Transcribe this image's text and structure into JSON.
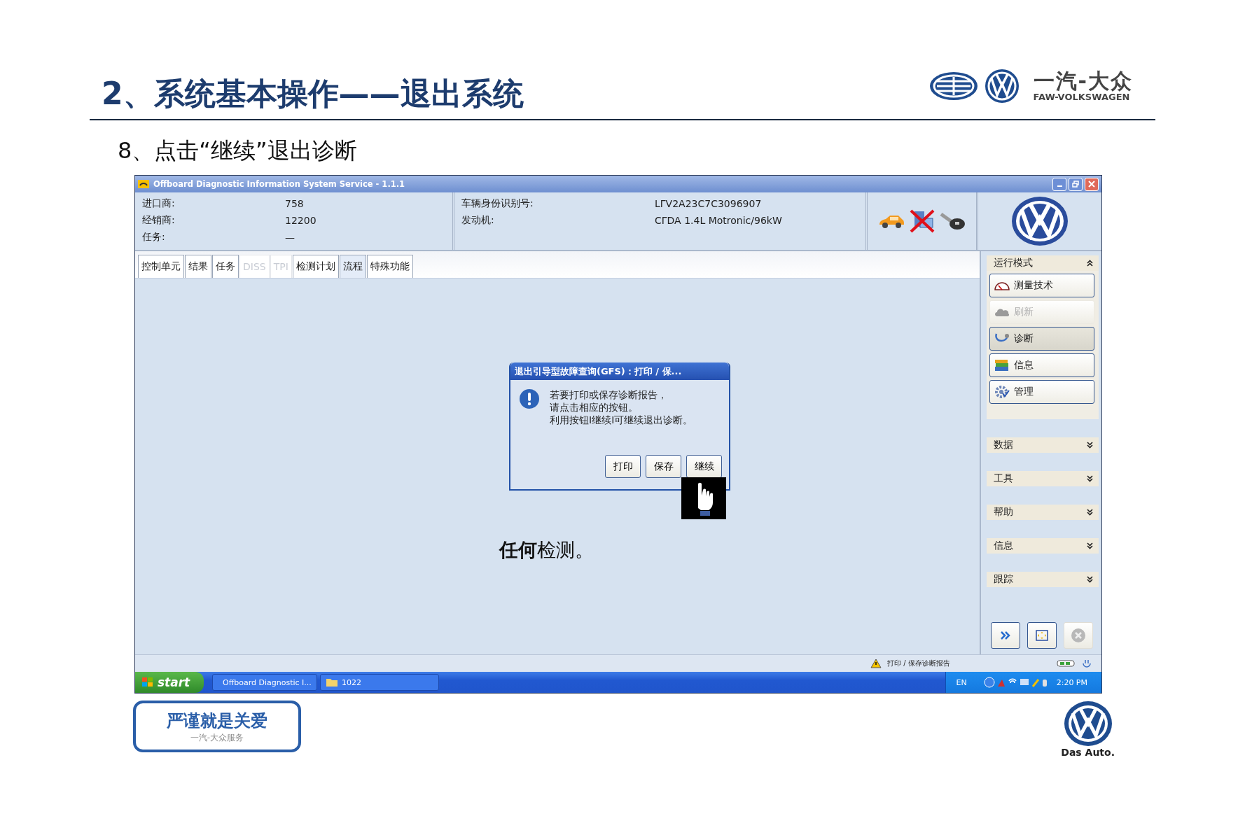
{
  "slide": {
    "title": "2、系统基本操作——退出系统",
    "subtitle": "8、点击“继续”退出诊断"
  },
  "brand": {
    "name_cn": "一汽-大众",
    "name_en": "FAW-VOLKSWAGEN"
  },
  "window": {
    "title": "Offboard Diagnostic Information System Service - 1.1.1"
  },
  "header_info": {
    "left": [
      {
        "label": "进口商:",
        "value": "758"
      },
      {
        "label": "经销商:",
        "value": "12200"
      },
      {
        "label": "任务:",
        "value": "—"
      }
    ],
    "right": [
      {
        "label": "车辆身份识别号:",
        "value": "LΓV2A23C7C3096907"
      },
      {
        "label": "发动机:",
        "value": "CΓDA 1.4L Motronic/96kW"
      }
    ]
  },
  "tabs": [
    {
      "label": "控制单元",
      "selected": false,
      "disabled": false
    },
    {
      "label": "结果",
      "selected": false,
      "disabled": false
    },
    {
      "label": "任务",
      "selected": false,
      "disabled": false
    },
    {
      "label": "DISS",
      "selected": false,
      "disabled": true
    },
    {
      "label": "TPI",
      "selected": false,
      "disabled": true
    },
    {
      "label": "检测计划",
      "selected": false,
      "disabled": false
    },
    {
      "label": "流程",
      "selected": true,
      "disabled": false
    },
    {
      "label": "特殊功能",
      "selected": false,
      "disabled": false
    }
  ],
  "dialog": {
    "title": "退出引导型故障查询(GFS)：打印 / 保...",
    "message_lines": [
      "若要打印或保存诊断报告，",
      "请点击相应的按钮。",
      "利用按钮I继续I可继续退出诊断。"
    ],
    "buttons": [
      "打印",
      "保存",
      "继续"
    ]
  },
  "main_message": "**任何**检测。",
  "sidebar": {
    "sections": [
      {
        "title": "运行模式",
        "expanded": true,
        "items": [
          {
            "label": "测量技术",
            "disabled": false,
            "selected": false
          },
          {
            "label": "刷新",
            "disabled": true,
            "selected": false
          },
          {
            "label": "诊断",
            "disabled": false,
            "selected": true
          },
          {
            "label": "信息",
            "disabled": false,
            "selected": false
          },
          {
            "label": "管理",
            "disabled": false,
            "selected": false
          }
        ]
      },
      {
        "title": "数据",
        "expanded": false
      },
      {
        "title": "工具",
        "expanded": false
      },
      {
        "title": "帮助",
        "expanded": false
      },
      {
        "title": "信息",
        "expanded": false
      },
      {
        "title": "跟踪",
        "expanded": false
      }
    ]
  },
  "status_bar": {
    "message": "打印 / 保存诊断报告"
  },
  "taskbar": {
    "start": "start",
    "tasks": [
      {
        "label": "Offboard Diagnostic I...",
        "kind": "app"
      },
      {
        "label": "1022",
        "kind": "folder"
      }
    ],
    "language": "EN",
    "time": "2:20 PM"
  },
  "footer": {
    "slogan": "严谨就是关爱",
    "slogan_sub": "一汽-大众服务",
    "tagline": "Das Auto."
  }
}
